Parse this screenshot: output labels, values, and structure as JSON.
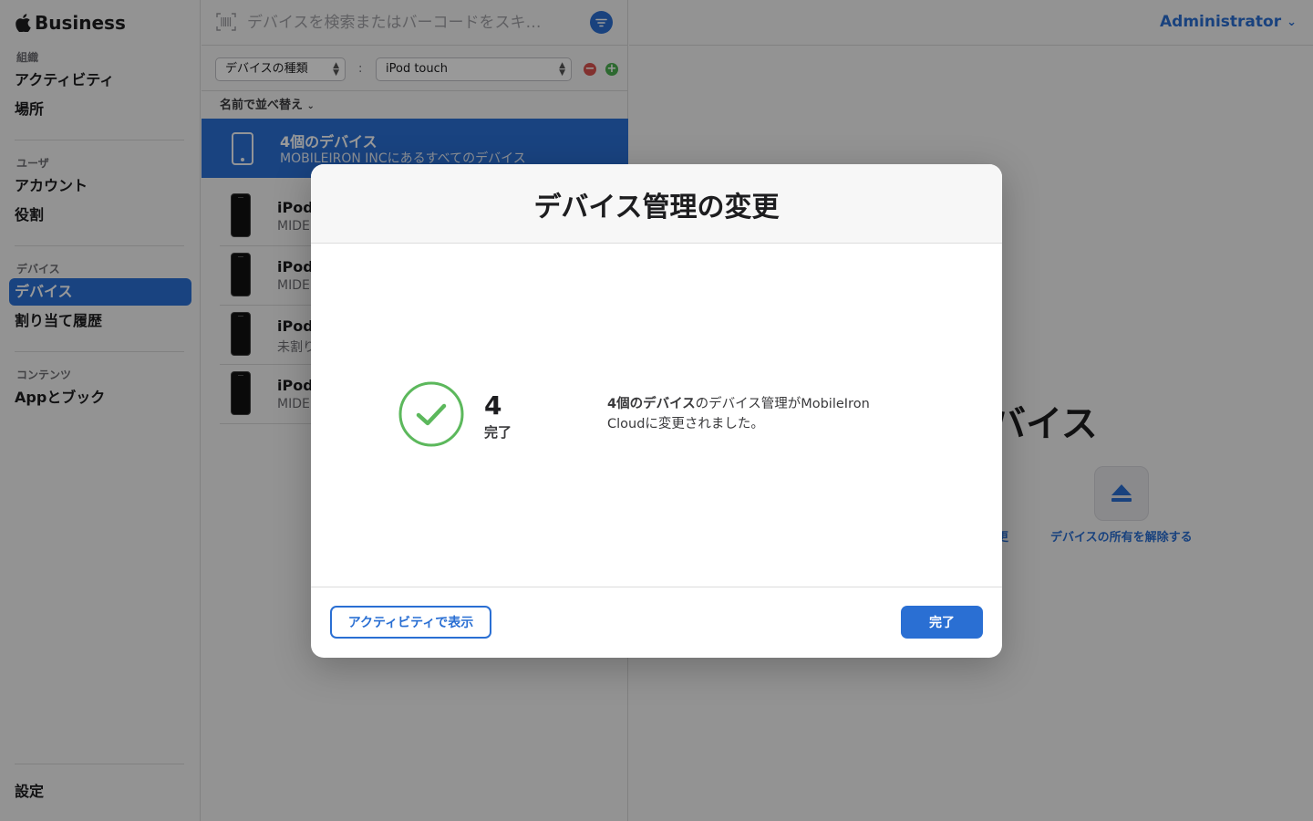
{
  "app": {
    "brand": "Business"
  },
  "sidebar": {
    "sections": [
      {
        "heading": "組織",
        "items": [
          "アクティビティ",
          "場所"
        ]
      },
      {
        "heading": "ユーザ",
        "items": [
          "アカウント",
          "役割"
        ]
      },
      {
        "heading": "デバイス",
        "items": [
          "デバイス",
          "割り当て履歴"
        ]
      },
      {
        "heading": "コンテンツ",
        "items": [
          "Appとブック"
        ]
      }
    ],
    "active_item": "デバイス",
    "settings": "設定"
  },
  "search": {
    "placeholder": "デバイスを検索またはバーコードをスキ…"
  },
  "filter": {
    "field": "デバイスの種類",
    "separator": ":",
    "value": "iPod touch",
    "remove_icon": "minus-circle-icon",
    "add_icon": "plus-circle-icon"
  },
  "sort": {
    "label": "名前で並べ替え"
  },
  "group": {
    "title": "4個のデバイス",
    "subtitle": "MOBILEIRON INCにあるすべてのデバイス"
  },
  "devices": [
    {
      "name": "iPod",
      "sub": "MIDE"
    },
    {
      "name": "iPod",
      "sub": "MIDE"
    },
    {
      "name": "iPod",
      "sub": "未割り"
    },
    {
      "name": "iPod",
      "sub": "MIDE"
    }
  ],
  "header_right": {
    "user": "Administrator"
  },
  "detail": {
    "title_partial": "バイス",
    "action_partial": "更",
    "release_action": "デバイスの所有を解除する"
  },
  "modal": {
    "title": "デバイス管理の変更",
    "count": "4",
    "count_label": "完了",
    "message_bold": "4個のデバイス",
    "message_rest": "のデバイス管理がMobileIron Cloudに変更されました。",
    "secondary_button": "アクティビティで表示",
    "primary_button": "完了"
  },
  "colors": {
    "accent": "#2a6fd3",
    "success": "#5cb85c",
    "remove": "#d9534f",
    "add": "#4caf50"
  }
}
